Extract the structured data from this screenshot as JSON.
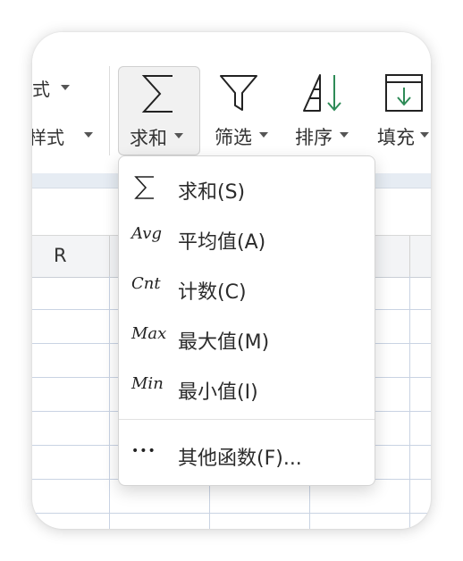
{
  "ribbon": {
    "format_row1": "式",
    "format_row2": "样式",
    "tools": [
      {
        "label": "求和",
        "icon": "sigma-icon"
      },
      {
        "label": "筛选",
        "icon": "funnel-icon"
      },
      {
        "label": "排序",
        "icon": "sort-icon"
      },
      {
        "label": "填充",
        "icon": "fill-down-icon"
      }
    ]
  },
  "sheet": {
    "column_header": "R"
  },
  "sum_menu": {
    "items": [
      {
        "icon_text": "∑",
        "label": "求和(S)"
      },
      {
        "icon_text": "Avg",
        "label": "平均值(A)"
      },
      {
        "icon_text": "Cnt",
        "label": "计数(C)"
      },
      {
        "icon_text": "Max",
        "label": "最大值(M)"
      },
      {
        "icon_text": "Min",
        "label": "最小值(I)"
      }
    ],
    "more": {
      "icon_text": "•••",
      "label": "其他函数(F)..."
    }
  },
  "colors": {
    "accent_green": "#2e8b57",
    "grid_line": "#c9d3e3"
  }
}
